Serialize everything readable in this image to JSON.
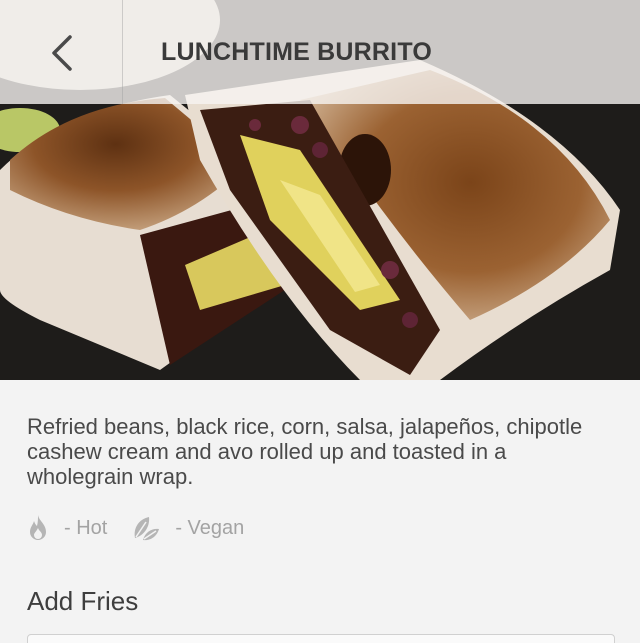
{
  "header": {
    "title": "LUNCHTIME BURRITO",
    "back_icon": "chevron-left-icon"
  },
  "hero": {
    "image": "burrito-photo"
  },
  "item": {
    "description": "Refried beans, black rice, corn, salsa, jalapeños, chipotle cashew cream and avo rolled up and toasted in a wholegrain wrap.",
    "tags": [
      {
        "icon": "flame-icon",
        "label": "- Hot"
      },
      {
        "icon": "leaves-icon",
        "label": "- Vegan"
      }
    ]
  },
  "options": {
    "add_fries_label": "Add Fries"
  },
  "colors": {
    "header_overlay": "#f6f4f1",
    "title_text": "#3a3a3a",
    "body_text": "#4a4a4a",
    "tag_grey": "#a3a3a3",
    "background": "#f3f3f3"
  }
}
